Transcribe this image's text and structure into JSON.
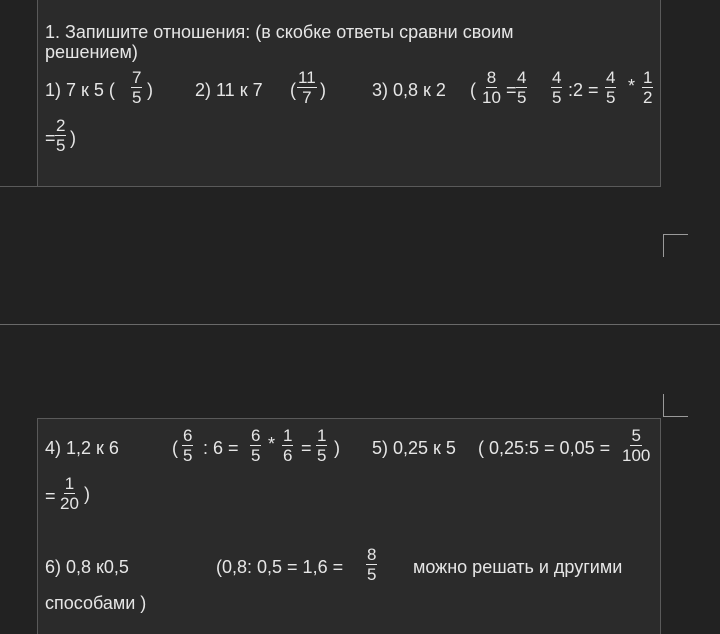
{
  "top": {
    "line1": "1. Запишите отношения: (в скобке ответы  сравни своим",
    "line2": "решением)",
    "p1": "1) 7 к 5  (",
    "p1_frac": {
      "n": "7",
      "d": "5"
    },
    "p1_close": ")",
    "p2": "2) 11 к 7",
    "p2_open": "(",
    "p2_frac": {
      "n": "11",
      "d": "7"
    },
    "p2_close": ")",
    "p3": "3) 0,8 к 2",
    "p3_open": "(",
    "p3_f1": {
      "n": "8",
      "d": "10"
    },
    "eq1": "=",
    "p3_f2": {
      "n": "4",
      "d": "5"
    },
    "p3_f3": {
      "n": "4",
      "d": "5"
    },
    "div2": ":2 =",
    "p3_f4": {
      "n": "4",
      "d": "5"
    },
    "mul": "*",
    "p3_f5": {
      "n": "1",
      "d": "2"
    },
    "eq2": "=",
    "p3_f6": {
      "n": "2",
      "d": "5"
    },
    "p3_close": ")"
  },
  "bottom": {
    "p4": "4) 1,2 к 6",
    "p4_open": "(",
    "p4_f1": {
      "n": "6",
      "d": "5"
    },
    "p4_div": ": 6 =",
    "p4_f2": {
      "n": "6",
      "d": "5"
    },
    "p4_mul": "*",
    "p4_f3": {
      "n": "1",
      "d": "6"
    },
    "p4_eq": "=",
    "p4_f4": {
      "n": "1",
      "d": "5"
    },
    "p4_close": ")",
    "p5": "5) 0,25 к 5",
    "p5_calc": "( 0,25:5 = 0,05 =",
    "p5_f1": {
      "n": "5",
      "d": "100"
    },
    "p5_eq": "=",
    "p5_f2": {
      "n": "1",
      "d": "20"
    },
    "p5_close": ")",
    "p6": "6)  0,8  к0,5",
    "p6_calc": "(0,8:  0,5  =  1,6  =",
    "p6_f1": {
      "n": "8",
      "d": "5"
    },
    "p6_note": "можно  решать  и  другими",
    "p6_note2": "способами )"
  }
}
